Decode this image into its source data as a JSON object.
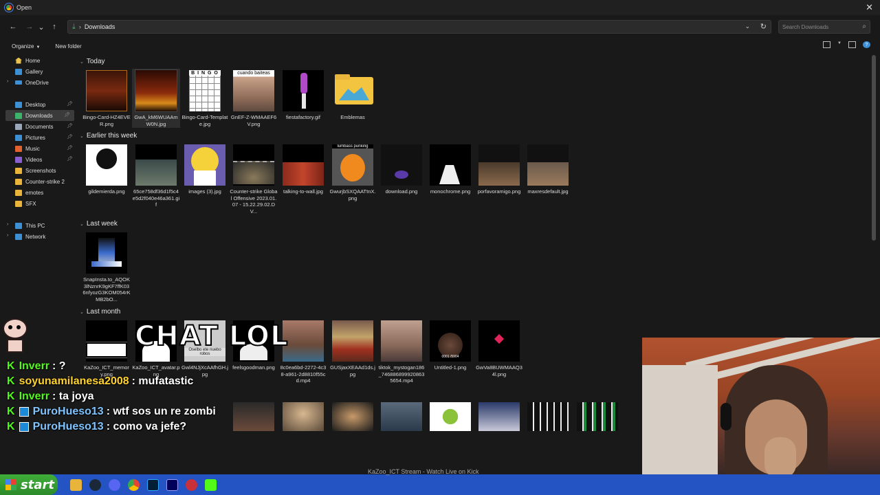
{
  "window": {
    "title": "Open",
    "close_label": "✕"
  },
  "address": {
    "current_folder": "Downloads",
    "search_placeholder": "Search Downloads"
  },
  "toolbar": {
    "organize_label": "Organize",
    "new_folder_label": "New folder"
  },
  "sidebar": {
    "items": [
      {
        "label": "Home",
        "icon": "home-icon"
      },
      {
        "label": "Gallery",
        "icon": "gallery-icon"
      },
      {
        "label": "OneDrive",
        "icon": "cloud-icon"
      },
      {
        "label": "Desktop",
        "icon": "desktop-icon"
      },
      {
        "label": "Downloads",
        "icon": "download-icon"
      },
      {
        "label": "Documents",
        "icon": "document-icon"
      },
      {
        "label": "Pictures",
        "icon": "pictures-icon"
      },
      {
        "label": "Music",
        "icon": "music-icon"
      },
      {
        "label": "Videos",
        "icon": "videos-icon"
      },
      {
        "label": "Screenshots",
        "icon": "folder-icon"
      },
      {
        "label": "Counter-strike 2",
        "icon": "folder-icon"
      },
      {
        "label": "emotes",
        "icon": "folder-icon"
      },
      {
        "label": "SFX",
        "icon": "folder-icon"
      },
      {
        "label": "This PC",
        "icon": "pc-icon"
      },
      {
        "label": "Network",
        "icon": "network-icon"
      }
    ]
  },
  "groups": {
    "today": "Today",
    "earlier": "Earlier this week",
    "lastweek": "Last week",
    "lastmonth": "Last month"
  },
  "files_today": [
    "Bingo-Card-HZ4EVER.png",
    "GwA_kM6WUAAmW0N.jpg",
    "Bingo-Card-Template.jpg",
    "GnEF-Z-WMAAEF6V.png",
    "fiestafactory.gif",
    "Emblemas"
  ],
  "files_earlier": [
    "gildemierda.png",
    "65ce758df36d1f5c4e5d2f040e46a361.gif",
    "images (3).jpg",
    "Counter-strike Global Offensive 2023.01.07 - 15.22.29.02.DV...",
    "talking-to-wall.jpg",
    "GwurjbSXQAATtnX.png",
    "download.png",
    "monochrome.png",
    "porfavoramigo.png",
    "maxresdefault.jpg"
  ],
  "files_lastweek": [
    "SnapInsta.to_AQOK3lNznrK9gKF7ffK036nfyozG3KOM054rKMB2bO..."
  ],
  "files_lastmonth": [
    "KaZoo_ICT_memory.png",
    "KaZoo_ICT_avatar.png",
    "Gwl4NJjXcAAfhGH.jpg",
    "feelsgoodman.png",
    "8c0ea6bd-2272-4c38-a961-2d8810f55cd.mp4",
    "GUSjaxXEAAd1ds.jpg",
    "tiktok_mystogan186_7468868999208635654.mp4",
    "Untitled-1.png",
    "GwVa8BUWMAAQ34l.png"
  ],
  "thumb_texts": {
    "bingo": "B I N G O",
    "caption": "cuando baiteas",
    "punk": "lumbass punking",
    "oselbo": "Oselbo ete nuebo robos",
    "counter": "0001 /5904"
  },
  "chat": {
    "overlay_text": "CHAT LOL",
    "messages": [
      {
        "user": "Inverr",
        "text": ": ?"
      },
      {
        "user": "soyunamilanesa2008",
        "text": ": mufatastic"
      },
      {
        "user": "Inverr",
        "text": ": ta joya"
      },
      {
        "user": "PuroHueso13",
        "text": ": wtf sos un re zombi"
      },
      {
        "user": "PuroHueso13",
        "text": ": como va jefe?"
      }
    ]
  },
  "taskbar": {
    "start_label": "start",
    "stream_title": "KaZoo_ICT Stream - Watch Live on Kick"
  },
  "colors": {
    "accent": "#3bb36b",
    "kick_green": "#53fc18",
    "taskbar": "#2453c4"
  }
}
